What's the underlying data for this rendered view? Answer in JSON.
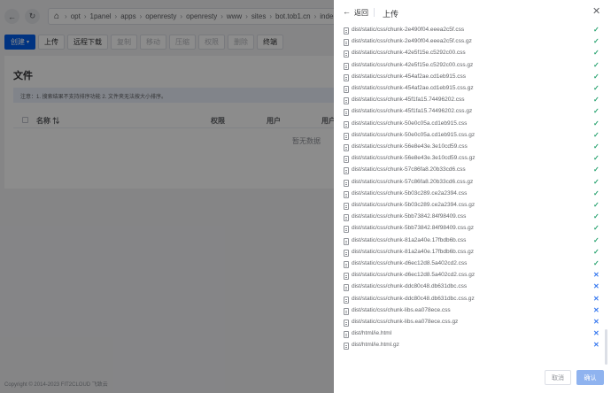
{
  "topbar": {
    "back_icon": "arrow-left-icon",
    "refresh_icon": "refresh-icon",
    "home_icon": "home-icon",
    "path_segments": [
      "opt",
      "1panel",
      "apps",
      "openresty",
      "openresty",
      "www",
      "sites",
      "bot.tob1.cn",
      "inde"
    ]
  },
  "toolbar": {
    "create_label": "创建",
    "upload_label": "上传",
    "remote_download_label": "远程下载",
    "copy_label": "复制",
    "move_label": "移动",
    "compress_label": "压缩",
    "permission_label": "权限",
    "delete_label": "删除",
    "terminal_label": "终端"
  },
  "panel": {
    "title": "文件",
    "notice": "注意：1. 搜索结果不支持排序功能 2. 文件夹无法按大小排序。",
    "columns": {
      "name": "名称 ⇅",
      "permission": "权限",
      "user": "用户",
      "group": "用户"
    },
    "empty_text": "暂无数据"
  },
  "footer": {
    "copyright": "Copyright © 2014-2023 FIT2CLOUD 飞致云"
  },
  "drawer": {
    "back_label": "返回",
    "title": "上传",
    "cancel_label": "取消",
    "confirm_label": "确认",
    "colors": {
      "success": "#2ba471",
      "failed": "#3b7cf0",
      "primary": "#005eeb"
    },
    "files": [
      {
        "name": "dist/static/css/chunk-2e490f04.eeea2c5f.css",
        "status": "ok"
      },
      {
        "name": "dist/static/css/chunk-2e490f04.eeea2c5f.css.gz",
        "status": "ok"
      },
      {
        "name": "dist/static/css/chunk-42e5f15e.c5292c00.css",
        "status": "ok"
      },
      {
        "name": "dist/static/css/chunk-42e5f15e.c5292c00.css.gz",
        "status": "ok"
      },
      {
        "name": "dist/static/css/chunk-454af2ae.cd1eb915.css",
        "status": "ok"
      },
      {
        "name": "dist/static/css/chunk-454af2ae.cd1eb915.css.gz",
        "status": "ok"
      },
      {
        "name": "dist/static/css/chunk-45f1fa15.74496202.css",
        "status": "ok"
      },
      {
        "name": "dist/static/css/chunk-45f1fa15.74496202.css.gz",
        "status": "ok"
      },
      {
        "name": "dist/static/css/chunk-50e0c05a.cd1eb915.css",
        "status": "ok"
      },
      {
        "name": "dist/static/css/chunk-50e0c05a.cd1eb915.css.gz",
        "status": "ok"
      },
      {
        "name": "dist/static/css/chunk-56e8e43e.3e10cd59.css",
        "status": "ok"
      },
      {
        "name": "dist/static/css/chunk-56e8e43e.3e10cd59.css.gz",
        "status": "ok"
      },
      {
        "name": "dist/static/css/chunk-57c86fa8.20b33cd6.css",
        "status": "ok"
      },
      {
        "name": "dist/static/css/chunk-57c86fa8.20b33cd6.css.gz",
        "status": "ok"
      },
      {
        "name": "dist/static/css/chunk-5b03c289.ce2a2394.css",
        "status": "ok"
      },
      {
        "name": "dist/static/css/chunk-5b03c289.ce2a2394.css.gz",
        "status": "ok"
      },
      {
        "name": "dist/static/css/chunk-5bb73842.84f98409.css",
        "status": "ok"
      },
      {
        "name": "dist/static/css/chunk-5bb73842.84f98409.css.gz",
        "status": "ok"
      },
      {
        "name": "dist/static/css/chunk-81a2a40e.17fbdb6b.css",
        "status": "ok"
      },
      {
        "name": "dist/static/css/chunk-81a2a40e.17fbdb6b.css.gz",
        "status": "ok"
      },
      {
        "name": "dist/static/css/chunk-d6ec12d8.5a402cd2.css",
        "status": "ok"
      },
      {
        "name": "dist/static/css/chunk-d6ec12d8.5a402cd2.css.gz",
        "status": "fail"
      },
      {
        "name": "dist/static/css/chunk-ddc80c48.db631dbc.css",
        "status": "fail"
      },
      {
        "name": "dist/static/css/chunk-ddc80c48.db631dbc.css.gz",
        "status": "fail"
      },
      {
        "name": "dist/static/css/chunk-libs.ea078ece.css",
        "status": "fail"
      },
      {
        "name": "dist/static/css/chunk-libs.ea078ece.css.gz",
        "status": "fail"
      },
      {
        "name": "dist/html/ie.html",
        "status": "fail"
      },
      {
        "name": "dist/html/ie.html.gz",
        "status": "fail"
      }
    ]
  }
}
